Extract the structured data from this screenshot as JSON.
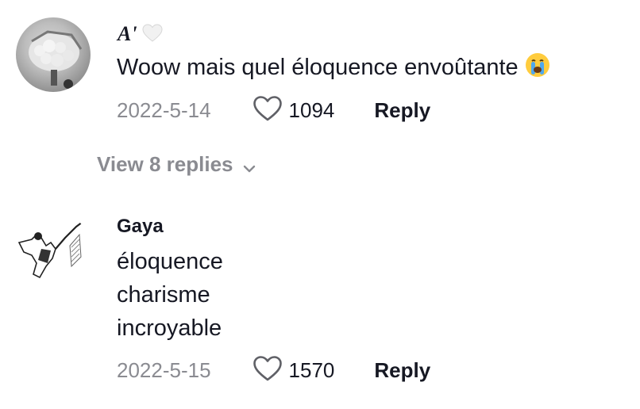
{
  "comments": [
    {
      "username": "A'",
      "badge_icon": "white-heart-icon",
      "text": "Woow mais quel éloquence envoûtante",
      "emoji_icon": "crying-face-icon",
      "date": "2022-5-14",
      "likes": "1094",
      "reply_label": "Reply",
      "view_replies_label": "View 8 replies"
    },
    {
      "username": "Gaya",
      "text_lines": [
        "éloquence",
        "charisme",
        "incroyable"
      ],
      "date": "2022-5-15",
      "likes": "1570",
      "reply_label": "Reply"
    }
  ],
  "colors": {
    "primary_text": "#161823",
    "secondary_text": "#8a8b91"
  }
}
